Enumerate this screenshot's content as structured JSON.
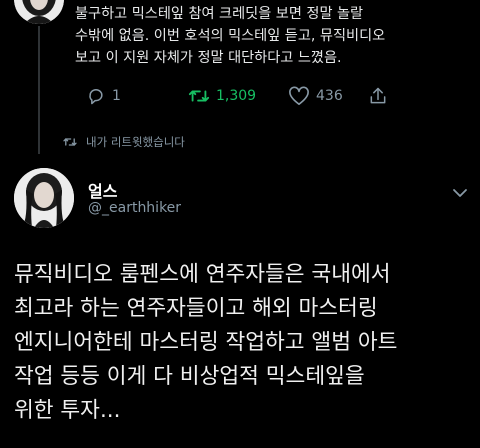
{
  "previous_tweet": {
    "lines": [
      "불구하고 믹스테잎 참여 크레딧을 보면 정말 놀랄",
      "수밖에 없음. 이번 호석의 믹스테잎 듣고, 뮤직비디오",
      "보고 이 지원 자체가 정말 대단하다고 느꼈음."
    ],
    "actions": {
      "reply_count": "1",
      "retweet_count": "1,309",
      "like_count": "436"
    }
  },
  "retweeted_label": "내가 리트윗했습니다",
  "tweet": {
    "author_name": "얼스",
    "author_handle": "@_earthhiker",
    "lines": [
      "뮤직비디오 룸펜스에 연주자들은 국내에서",
      "최고라 하는 연주자들이고 해외 마스터링",
      "엔지니어한테 마스터링 작업하고 앨범 아트",
      "작업 등등 이게 다 비상업적 믹스테잎을",
      "위한 투자..."
    ]
  },
  "colors": {
    "background": "#000000",
    "text": "#e7e9ea",
    "muted": "#8899a6",
    "retweet_active": "#17bf63"
  }
}
